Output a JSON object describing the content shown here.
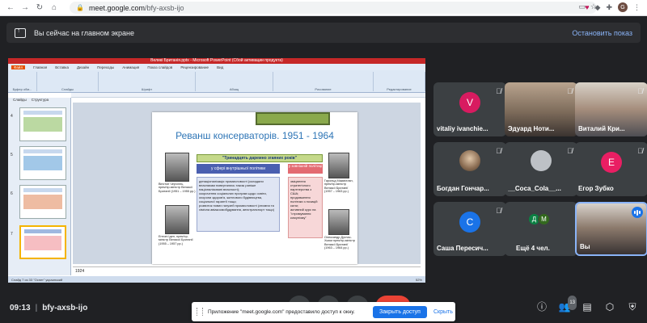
{
  "browser": {
    "url_domain": "meet.google.com",
    "url_path": "/bfy-axsb-ijo",
    "profile_initial": "G"
  },
  "banner": {
    "text": "Вы сейчас на главном экране",
    "stop_label": "Остановить показ"
  },
  "presentation": {
    "window_title": "Великі Британія.pptx - Microsoft PowerPoint (Сбой активации продукта)",
    "tabs": [
      "Файл",
      "Главная",
      "Вставка",
      "Дизайн",
      "Переходы",
      "Анимация",
      "Показ слайдов",
      "Рецензирование",
      "Вид"
    ],
    "ribbon_groups": [
      "Буфер обм...",
      "Слайды",
      "Шрифт",
      "Абзац",
      "Рисование",
      "Редактирование"
    ],
    "panel_tabs": [
      "Слайды",
      "Структура"
    ],
    "slide_numbers": [
      "4",
      "5",
      "6",
      "7"
    ],
    "slide": {
      "title": "Реванш консерваторів. 1951 - 1964",
      "slogan": "\"Тринадцять даремно згаяних років\"",
      "inner_label": "у сфері внутрішньої політики",
      "outer_label": "у зовнішній політиці",
      "inner_items": [
        "денаціоналізація промисловості (складали власникам повертались також раніше націоналізовані власності);",
        "скорочення соціальних програм щодо освіти, охорони здоров'я, житлового будівництва, соціальної гарантії тощо;",
        "розвиток нових галузей промисловості (атомна та хімічна авіакосмобудування, автотранспорт тощо)"
      ],
      "outer_items": [
        "зміцнення стратегічного партнерства з США;",
        "продовження політики з позицій сили;",
        "активний курс на \"стримування комунізму\""
      ],
      "captions": [
        "Вінстон Черчілль, прем'єр-міністр Великої Британії (1951 – 1955 рр.)",
        "Ентоні Іден, прем'єр-міністр Великої Британії (1955 – 1957 рр.)",
        "Гарольд Макміллан, прем'єр-міністр Великої Британії (1957 – 1963 рр.)",
        "Олександр Дуглас-Хьюм прем'єр-міністр Великої Британії (1963 – 1964 рр.)"
      ]
    },
    "notes": "1924",
    "status_left": "Слайд 7 из 33    \"Оснет\"    украинский",
    "status_right": "52%"
  },
  "participants": [
    {
      "name": "vitaliy ivanchie...",
      "initial": "V",
      "color": "#d81b60",
      "kind": "letter"
    },
    {
      "name": "Эдуард Ноти...",
      "kind": "video"
    },
    {
      "name": "Виталий Кри...",
      "kind": "video"
    },
    {
      "name": "Богдан Гончар...",
      "kind": "photo"
    },
    {
      "name": "__Coca_Cola__...",
      "kind": "default"
    },
    {
      "name": "Егор Зубко",
      "initial": "E",
      "color": "#e91e63",
      "kind": "letter"
    },
    {
      "name": "Саша Пересич...",
      "initial": "C",
      "color": "#1a73e8",
      "kind": "letter"
    },
    {
      "name": "Ещё 4 чел.",
      "kind": "more",
      "avatars": [
        "Д",
        "M"
      ]
    },
    {
      "name": "Вы",
      "kind": "self"
    }
  ],
  "bottom": {
    "time": "09:13",
    "meeting_code": "bfy-axsb-ijo",
    "participant_count": "13"
  },
  "share_prompt": {
    "message": "Приложение \"meet.google.com\" предоставило доступ к окну.",
    "stop_label": "Закрыть доступ",
    "hide_label": "Скрыть"
  },
  "colors": {
    "meet_bg": "#202124",
    "tile_bg": "#3c4043",
    "accent": "#8ab4f8",
    "end_call": "#ea4335"
  }
}
